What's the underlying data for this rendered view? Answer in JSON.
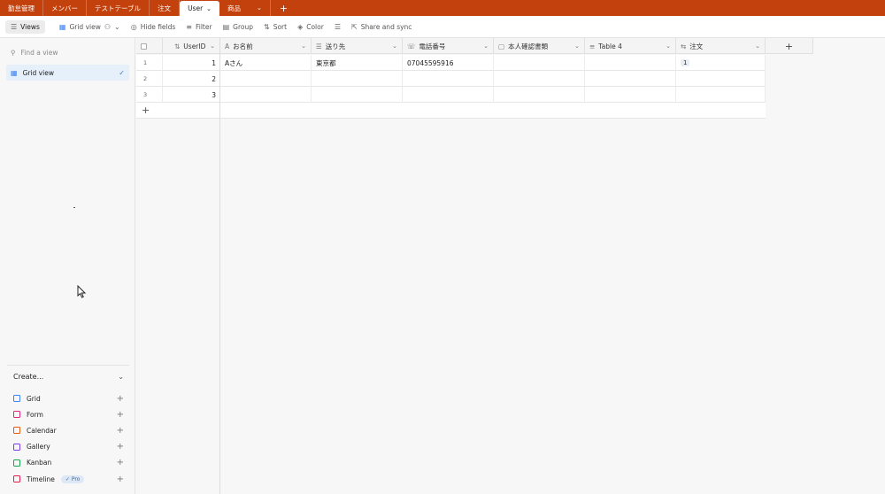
{
  "tabs": [
    {
      "label": "勤怠管理",
      "active": false
    },
    {
      "label": "メンバー",
      "active": false
    },
    {
      "label": "テストテーブル",
      "active": false
    },
    {
      "label": "注文",
      "active": false
    },
    {
      "label": "User",
      "active": true,
      "chevron": "⌄"
    },
    {
      "label": "商品",
      "active": false,
      "chevron": "⌄"
    }
  ],
  "toolbar": {
    "views_label": "Views",
    "grid_view_label": "Grid view",
    "hide_fields_label": "Hide fields",
    "filter_label": "Filter",
    "group_label": "Group",
    "sort_label": "Sort",
    "color_label": "Color",
    "share_label": "Share and sync"
  },
  "sidebar": {
    "find_placeholder": "Find a view",
    "views": [
      {
        "label": "Grid view",
        "selected": true
      }
    ],
    "create_label": "Create...",
    "create_items": [
      {
        "label": "Grid",
        "color": "#3b82f6"
      },
      {
        "label": "Form",
        "color": "#db2777"
      },
      {
        "label": "Calendar",
        "color": "#ea580c"
      },
      {
        "label": "Gallery",
        "color": "#7c3aed"
      },
      {
        "label": "Kanban",
        "color": "#16a34a"
      },
      {
        "label": "Timeline",
        "color": "#e11d48",
        "badge": "Pro"
      }
    ]
  },
  "grid": {
    "columns": [
      {
        "label": "UserID",
        "icon": "⇅"
      },
      {
        "label": "お名前",
        "icon": "A"
      },
      {
        "label": "送り先",
        "icon": "☰"
      },
      {
        "label": "電話番号",
        "icon": "☏"
      },
      {
        "label": "本人確認書類",
        "icon": "▢"
      },
      {
        "label": "Table 4",
        "icon": "≡"
      },
      {
        "label": "注文",
        "icon": "⇆"
      }
    ],
    "rows": [
      {
        "index": "1",
        "cells": [
          "1",
          "Aさん",
          "東京都",
          "07045595916",
          "",
          "",
          "1"
        ]
      },
      {
        "index": "2",
        "cells": [
          "2",
          "",
          "",
          "",
          "",
          "",
          ""
        ]
      },
      {
        "index": "3",
        "cells": [
          "3",
          "",
          "",
          "",
          "",
          "",
          ""
        ]
      }
    ]
  },
  "colors": {
    "tabbar": "#c2410c",
    "selected_view": "#e6f0fa"
  }
}
